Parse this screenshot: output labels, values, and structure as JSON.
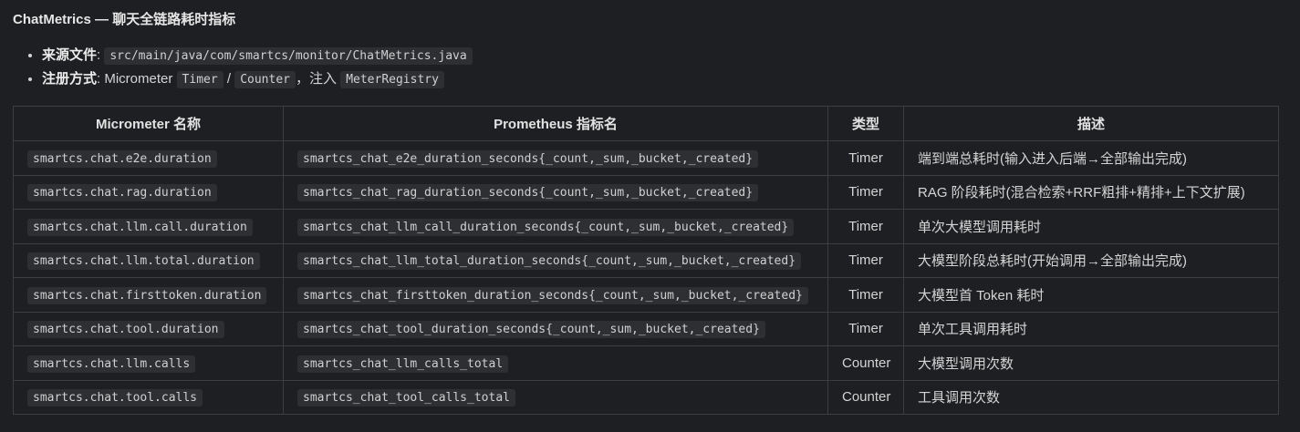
{
  "title": "ChatMetrics — 聊天全链路耗时指标",
  "meta": {
    "source_label": "来源文件",
    "source_path": "src/main/java/com/smartcs/monitor/ChatMetrics.java",
    "register_label": "注册方式",
    "register_lib": "Micrometer",
    "register_timer": "Timer",
    "register_sep": "/",
    "register_counter": "Counter",
    "register_inject": "，注入",
    "register_registry": "MeterRegistry"
  },
  "table": {
    "headers": [
      "Micrometer 名称",
      "Prometheus 指标名",
      "类型",
      "描述"
    ],
    "rows": [
      {
        "micrometer": "smartcs.chat.e2e.duration",
        "prometheus": "smartcs_chat_e2e_duration_seconds{_count,_sum,_bucket,_created}",
        "type": "Timer",
        "desc": "端到端总耗时(输入进入后端→全部输出完成)"
      },
      {
        "micrometer": "smartcs.chat.rag.duration",
        "prometheus": "smartcs_chat_rag_duration_seconds{_count,_sum,_bucket,_created}",
        "type": "Timer",
        "desc": "RAG 阶段耗时(混合检索+RRF粗排+精排+上下文扩展)"
      },
      {
        "micrometer": "smartcs.chat.llm.call.duration",
        "prometheus": "smartcs_chat_llm_call_duration_seconds{_count,_sum,_bucket,_created}",
        "type": "Timer",
        "desc": "单次大模型调用耗时"
      },
      {
        "micrometer": "smartcs.chat.llm.total.duration",
        "prometheus": "smartcs_chat_llm_total_duration_seconds{_count,_sum,_bucket,_created}",
        "type": "Timer",
        "desc": "大模型阶段总耗时(开始调用→全部输出完成)"
      },
      {
        "micrometer": "smartcs.chat.firsttoken.duration",
        "prometheus": "smartcs_chat_firsttoken_duration_seconds{_count,_sum,_bucket,_created}",
        "type": "Timer",
        "desc": "大模型首 Token 耗时"
      },
      {
        "micrometer": "smartcs.chat.tool.duration",
        "prometheus": "smartcs_chat_tool_duration_seconds{_count,_sum,_bucket,_created}",
        "type": "Timer",
        "desc": "单次工具调用耗时"
      },
      {
        "micrometer": "smartcs.chat.llm.calls",
        "prometheus": "smartcs_chat_llm_calls_total",
        "type": "Counter",
        "desc": "大模型调用次数"
      },
      {
        "micrometer": "smartcs.chat.tool.calls",
        "prometheus": "smartcs_chat_tool_calls_total",
        "type": "Counter",
        "desc": "工具调用次数"
      }
    ]
  }
}
